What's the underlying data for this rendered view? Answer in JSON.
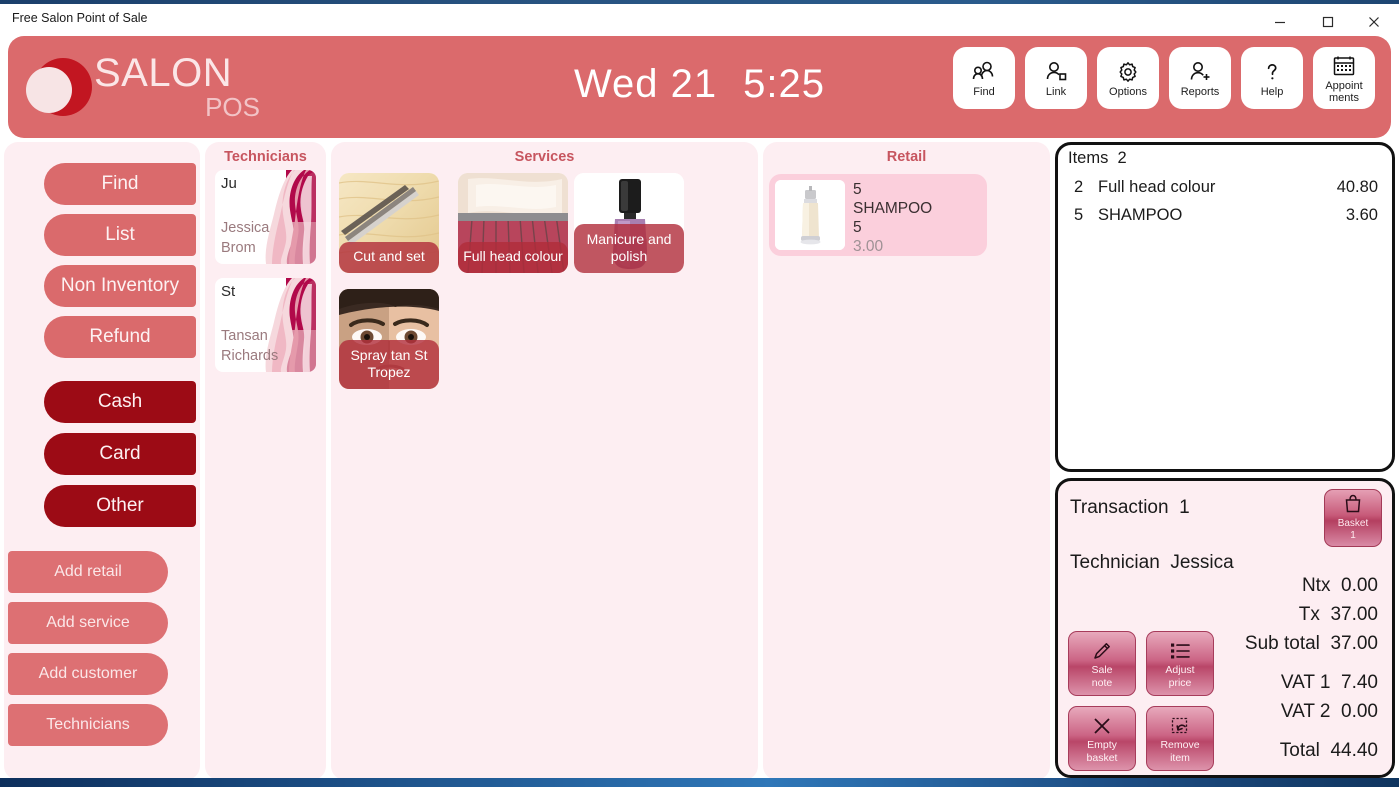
{
  "window": {
    "title": "Free Salon Point of Sale",
    "minimize": "minimize-icon",
    "maximize": "maximize-icon",
    "close": "close-icon"
  },
  "header": {
    "brand_line1": "SALON",
    "brand_line2": "POS",
    "date": "Wed 21",
    "time": "5:25",
    "accent_color": "#db6a6c",
    "toolbar": [
      {
        "label": "Find",
        "icon": "people-search-icon"
      },
      {
        "label": "Link",
        "icon": "person-link-icon"
      },
      {
        "label": "Options",
        "icon": "gear-icon"
      },
      {
        "label": "Reports",
        "icon": "person-add-icon"
      },
      {
        "label": "Help",
        "icon": "question-mark-icon"
      },
      {
        "label": "Appoint\nments",
        "icon": "calendar-icon"
      }
    ]
  },
  "actions": {
    "top_buttons": [
      {
        "label": "Find"
      },
      {
        "label": "List"
      },
      {
        "label": "Non Inventory"
      },
      {
        "label": "Refund"
      }
    ],
    "payment_buttons": [
      {
        "label": "Cash"
      },
      {
        "label": "Card"
      },
      {
        "label": "Other"
      }
    ],
    "add_buttons": [
      {
        "label": "Add retail"
      },
      {
        "label": "Add service"
      },
      {
        "label": "Add customer"
      },
      {
        "label": "Technicians"
      }
    ],
    "button_color": "#da6a6c",
    "payment_color": "#9c0b15"
  },
  "technicians": {
    "title": "Technicians",
    "items": [
      {
        "initials": "Ju",
        "first": "Jessica",
        "last": "Brom"
      },
      {
        "initials": "St",
        "first": "Tansan",
        "last": "Richards"
      }
    ]
  },
  "services": {
    "title": "Services",
    "items": [
      {
        "label": "Cut and set",
        "image": "blonde-hair-scissors-photo"
      },
      {
        "label": "Full head colour",
        "image": "hair-colour-brush-photo"
      },
      {
        "label": "Manicure and polish",
        "image": "nail-polish-bottle-photo"
      },
      {
        "label": "Spray tan St Tropez",
        "image": "tanned-face-photo"
      }
    ]
  },
  "retail": {
    "title": "Retail",
    "items": [
      {
        "code": "5",
        "name": "SHAMPOO",
        "qty": "5",
        "price": "3.00",
        "image": "shampoo-bottle-photo"
      }
    ]
  },
  "basket": {
    "header_label": "Items",
    "header_count": "2",
    "lines": [
      {
        "qty": "2",
        "name": "Full head colour",
        "price": "40.80"
      },
      {
        "qty": "5",
        "name": "SHAMPOO",
        "price": "3.60"
      }
    ]
  },
  "transaction": {
    "transaction_label": "Transaction",
    "transaction_number": "1",
    "technician_label": "Technician",
    "technician_name": "Jessica",
    "basket_button": {
      "label": "Basket",
      "count": "1",
      "icon": "shopping-bag-icon"
    },
    "totals": [
      {
        "label": "Ntx",
        "value": "0.00"
      },
      {
        "label": "Tx",
        "value": "37.00"
      },
      {
        "label": "Sub total",
        "value": "37.00"
      },
      {
        "label": "VAT 1",
        "value": "7.40"
      },
      {
        "label": "VAT 2",
        "value": "0.00"
      },
      {
        "label": "Total",
        "value": "44.40"
      }
    ],
    "tools": [
      {
        "line1": "Sale",
        "line2": "note",
        "icon": "pencil-icon"
      },
      {
        "line1": "Adjust",
        "line2": "price",
        "icon": "list-icon"
      },
      {
        "line1": "Empty",
        "line2": "basket",
        "icon": "x-icon"
      },
      {
        "line1": "Remove",
        "line2": "item",
        "icon": "undo-box-icon"
      }
    ]
  }
}
